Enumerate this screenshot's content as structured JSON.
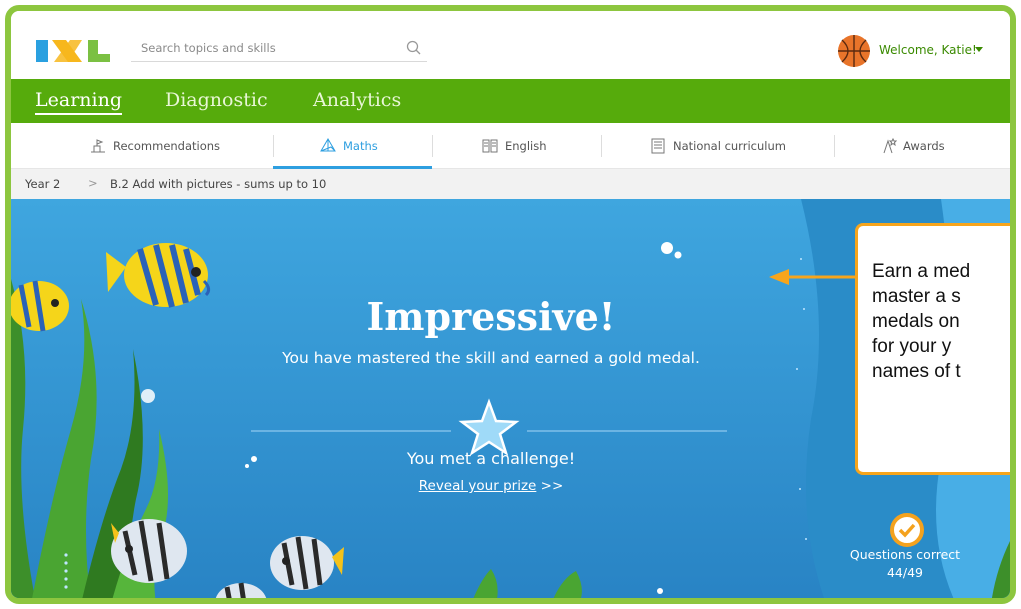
{
  "header": {
    "logo_text": "IXL",
    "search_placeholder": "Search topics and skills",
    "welcome": "Welcome, Katie!"
  },
  "main_nav": {
    "tabs": [
      {
        "label": "Learning",
        "active": true
      },
      {
        "label": "Diagnostic",
        "active": false
      },
      {
        "label": "Analytics",
        "active": false
      }
    ]
  },
  "sub_nav": {
    "tabs": [
      {
        "label": "Recommendations",
        "icon": "recommendations-icon"
      },
      {
        "label": "Maths",
        "icon": "maths-pyramid-icon",
        "active": true
      },
      {
        "label": "English",
        "icon": "book-icon"
      },
      {
        "label": "National curriculum",
        "icon": "curriculum-icon"
      },
      {
        "label": "Awards",
        "icon": "awards-icon"
      }
    ]
  },
  "breadcrumb": {
    "year": "Year 2",
    "separator": ">",
    "skill": "B.2 Add with pictures - sums up to 10"
  },
  "result": {
    "title": "Impressive!",
    "message": "You have mastered the skill and earned a gold medal.",
    "challenge": "You met a challenge!",
    "reveal_link": "Reveal your prize",
    "reveal_suffix": ">>",
    "stat_label": "Questions correct",
    "stat_value": "44/49"
  },
  "callout": {
    "lines": [
      "Earn a med",
      "master a s",
      "medals on",
      "for your y",
      "names of t"
    ]
  },
  "colors": {
    "frame": "#8dc63f",
    "green_nav": "#56ab0c",
    "accent_blue": "#2e9fe0",
    "ocean": "#2d94d2",
    "callout_orange": "#f7a51c"
  }
}
